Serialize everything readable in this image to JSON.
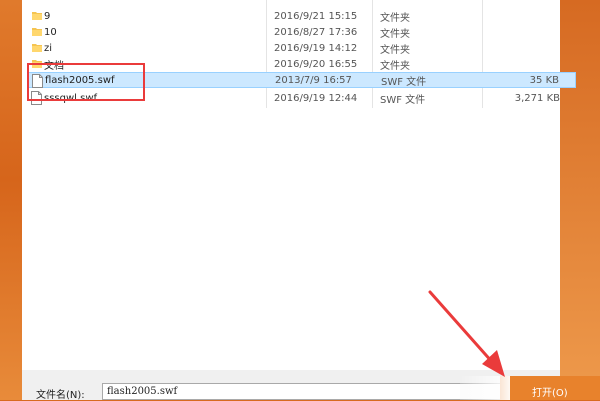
{
  "file_list": {
    "rows": [
      {
        "name": "9",
        "date": "2016/9/21 15:15",
        "type": "文件夹",
        "size": "",
        "kind": "folder",
        "selected": false
      },
      {
        "name": "10",
        "date": "2016/8/27 17:36",
        "type": "文件夹",
        "size": "",
        "kind": "folder",
        "selected": false
      },
      {
        "name": "zi",
        "date": "2016/9/19 14:12",
        "type": "文件夹",
        "size": "",
        "kind": "folder",
        "selected": false
      },
      {
        "name": "文档",
        "date": "2016/9/20 16:55",
        "type": "文件夹",
        "size": "",
        "kind": "folder",
        "selected": false
      },
      {
        "name": "flash2005.swf",
        "date": "2013/7/9 16:57",
        "type": "SWF 文件",
        "size": "35 KB",
        "kind": "file",
        "selected": true
      },
      {
        "name": "sssqwl.swf",
        "date": "2016/9/19 12:44",
        "type": "SWF 文件",
        "size": "3,271 KB",
        "kind": "file",
        "selected": false
      }
    ]
  },
  "bottom": {
    "filename_label": "文件名(N):",
    "filename_value": "flash2005.swf",
    "open_label": "打开(O)"
  },
  "colors": {
    "accent": "#e8822c",
    "highlight_box": "#ea3b3b",
    "selection": "#cce8ff",
    "folder": "#f5c451"
  }
}
